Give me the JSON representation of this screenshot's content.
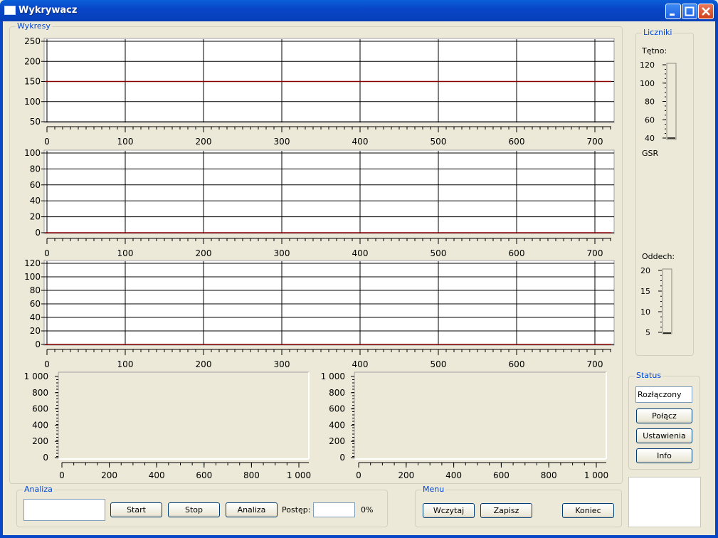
{
  "window": {
    "title": "Wykrywacz"
  },
  "plots_group": {
    "label": "Wykresy"
  },
  "plots": [
    {
      "yticks": [
        "250",
        "200",
        "150",
        "100",
        "50"
      ],
      "xticks": [
        "0",
        "100",
        "200",
        "300",
        "400",
        "500",
        "600",
        "700"
      ],
      "ylim": [
        50,
        250
      ],
      "line_value": 150
    },
    {
      "yticks": [
        "100",
        "80",
        "60",
        "40",
        "20",
        "0"
      ],
      "xticks": [
        "0",
        "100",
        "200",
        "300",
        "400",
        "500",
        "600",
        "700"
      ],
      "ylim": [
        0,
        100
      ],
      "line_value": 0
    },
    {
      "yticks": [
        "120",
        "100",
        "80",
        "60",
        "40",
        "20",
        "0"
      ],
      "xticks": [
        "0",
        "100",
        "200",
        "300",
        "400",
        "500",
        "600",
        "700"
      ],
      "ylim": [
        0,
        120
      ],
      "line_value": 0
    }
  ],
  "small_plots": [
    {
      "yticks": [
        "1 000",
        "800",
        "600",
        "400",
        "200",
        "0"
      ],
      "xticks": [
        "0",
        "200",
        "400",
        "600",
        "800",
        "1 000"
      ]
    },
    {
      "yticks": [
        "1 000",
        "800",
        "600",
        "400",
        "200",
        "0"
      ],
      "xticks": [
        "0",
        "200",
        "400",
        "600",
        "800",
        "1 000"
      ]
    }
  ],
  "counters": {
    "label": "Liczniki",
    "pulse_label": "Tętno:",
    "pulse_ticks": [
      "120",
      "100",
      "80",
      "60",
      "40"
    ],
    "pulse_value": 40,
    "gsr_label": "GSR",
    "breath_label": "Oddech:",
    "breath_ticks": [
      "20",
      "15",
      "10",
      "5"
    ],
    "breath_value": 2
  },
  "status": {
    "label": "Status",
    "value": "Rozłączony",
    "connect": "Połącz",
    "settings": "Ustawienia",
    "info": "Info"
  },
  "analysis": {
    "label": "Analiza",
    "start": "Start",
    "stop": "Stop",
    "analyze": "Analiza",
    "progress_label": "Postęp:",
    "progress_value": "0%"
  },
  "menu": {
    "label": "Menu",
    "load": "Wczytaj",
    "save": "Zapisz",
    "exit": "Koniec"
  },
  "colors": {
    "accent": "#0046d5",
    "series": "#8b0000",
    "titlebar": "#0846c8"
  }
}
